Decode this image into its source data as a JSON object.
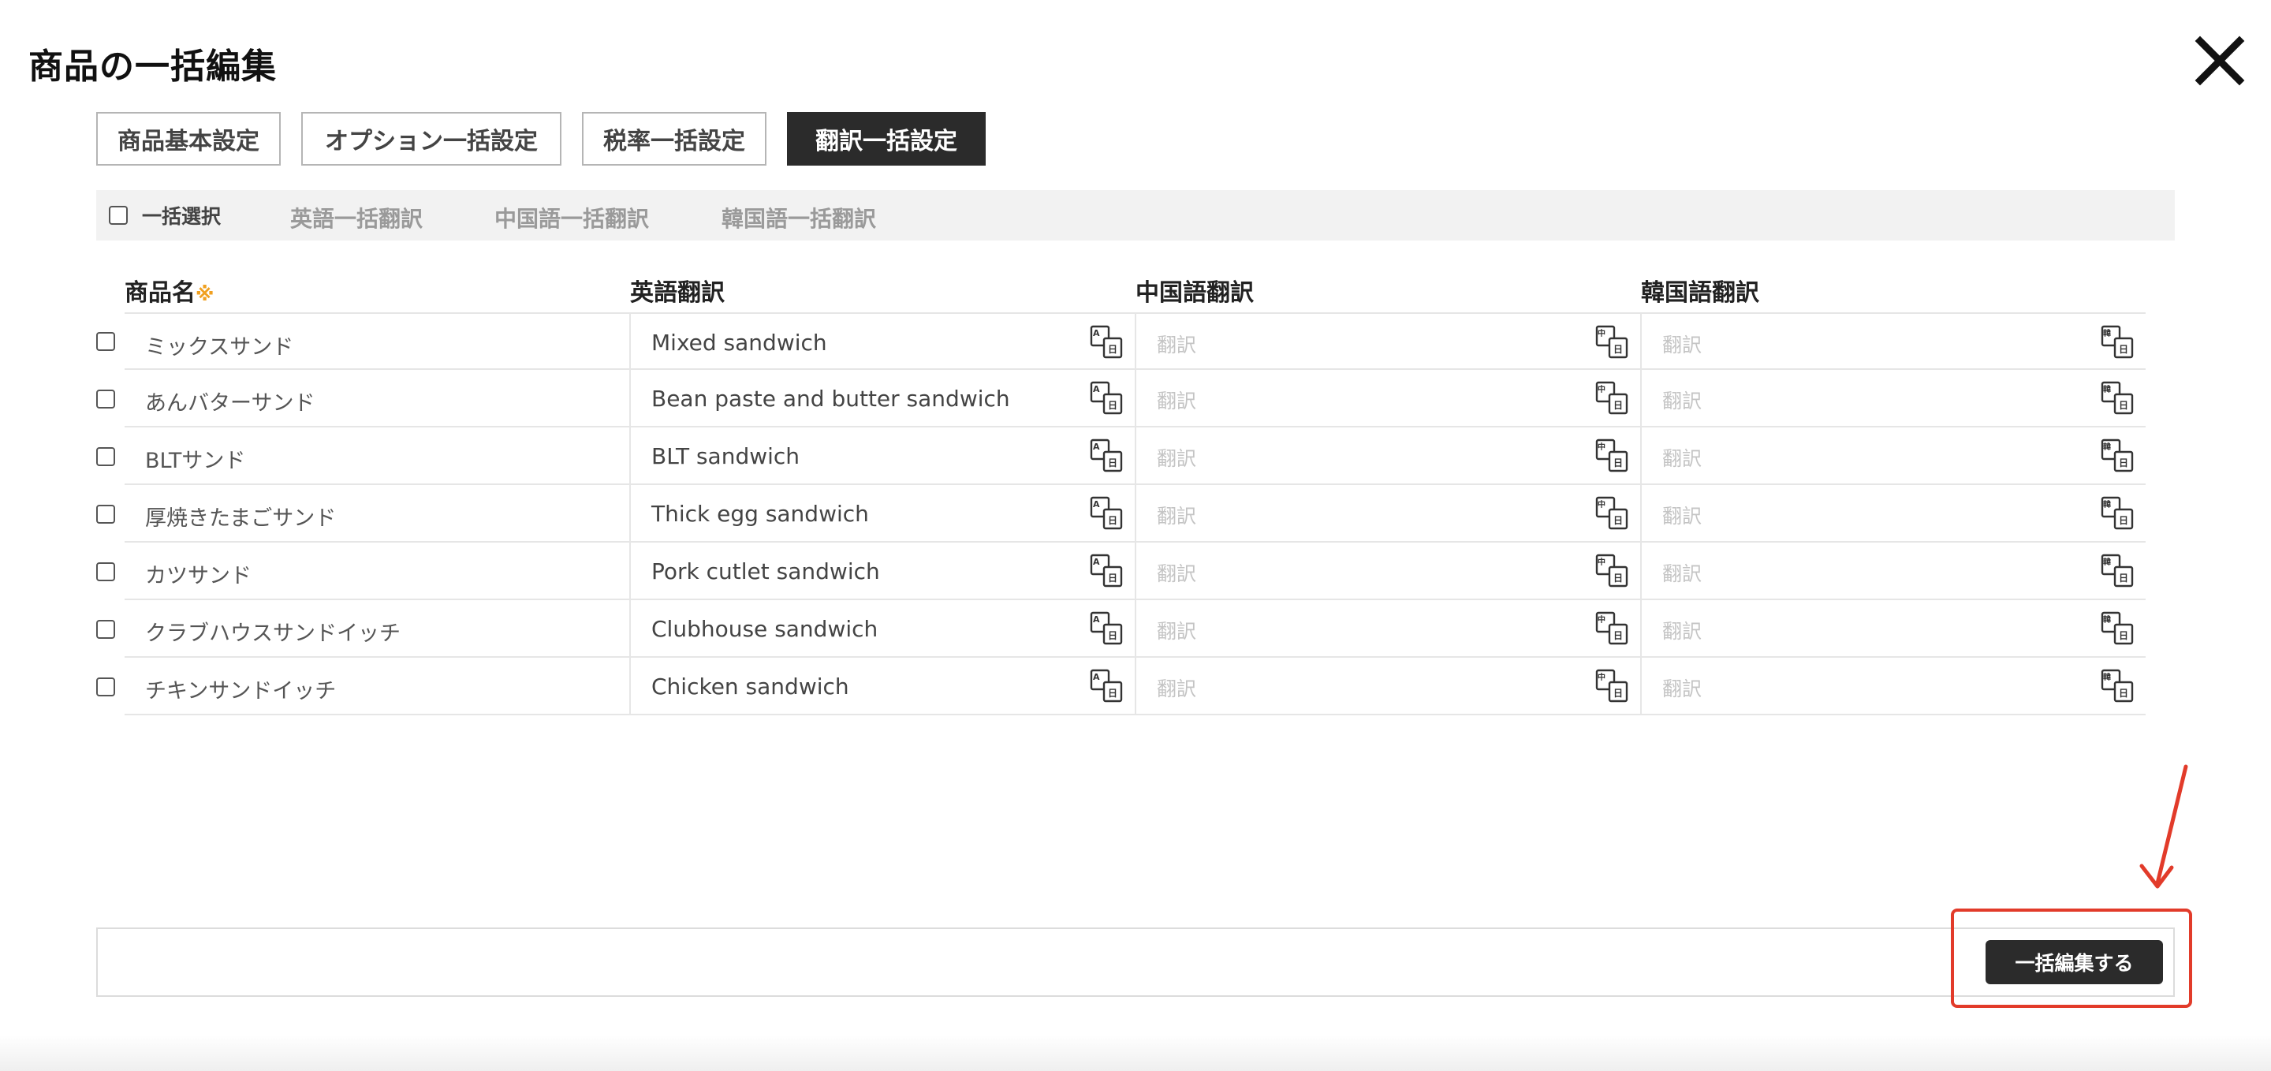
{
  "modal": {
    "title": "商品の一括編集"
  },
  "tabs": [
    {
      "label": "商品基本設定",
      "active": false
    },
    {
      "label": "オプション一括設定",
      "active": false
    },
    {
      "label": "税率一括設定",
      "active": false
    },
    {
      "label": "翻訳一括設定",
      "active": true
    }
  ],
  "bulk_bar": {
    "select_all_label": "一括選択",
    "english_bulk": "英語一括翻訳",
    "chinese_bulk": "中国語一括翻訳",
    "korean_bulk": "韓国語一括翻訳"
  },
  "columns": {
    "name": "商品名",
    "required_mark": "※",
    "english": "英語翻訳",
    "chinese": "中国語翻訳",
    "korean": "韓国語翻訳"
  },
  "placeholder": "翻訳",
  "rows": [
    {
      "name": "ミックスサンド",
      "english": "Mixed sandwich",
      "chinese": "",
      "korean": ""
    },
    {
      "name": "あんバターサンド",
      "english": "Bean paste and butter sandwich",
      "chinese": "",
      "korean": ""
    },
    {
      "name": "BLTサンド",
      "english": "BLT sandwich",
      "chinese": "",
      "korean": ""
    },
    {
      "name": "厚焼きたまごサンド",
      "english": "Thick egg sandwich",
      "chinese": "",
      "korean": ""
    },
    {
      "name": "カツサンド",
      "english": "Pork cutlet sandwich",
      "chinese": "",
      "korean": ""
    },
    {
      "name": "クラブハウスサンドイッチ",
      "english": "Clubhouse sandwich",
      "chinese": "",
      "korean": ""
    },
    {
      "name": "チキンサンドイッチ",
      "english": "Chicken sandwich",
      "chinese": "",
      "korean": ""
    }
  ],
  "icons": {
    "close": "close-icon",
    "english_translate": "translate-en-icon",
    "chinese_translate": "translate-zh-icon",
    "korean_translate": "translate-ko-icon",
    "annotation_arrow": "arrow-icon"
  },
  "footer": {
    "submit_label": "一括編集する"
  },
  "colors": {
    "primary_dark": "#2b2b2b",
    "required_mark": "#f0a020",
    "annotation": "#e23b2a",
    "placeholder": "#c4c4c4"
  }
}
